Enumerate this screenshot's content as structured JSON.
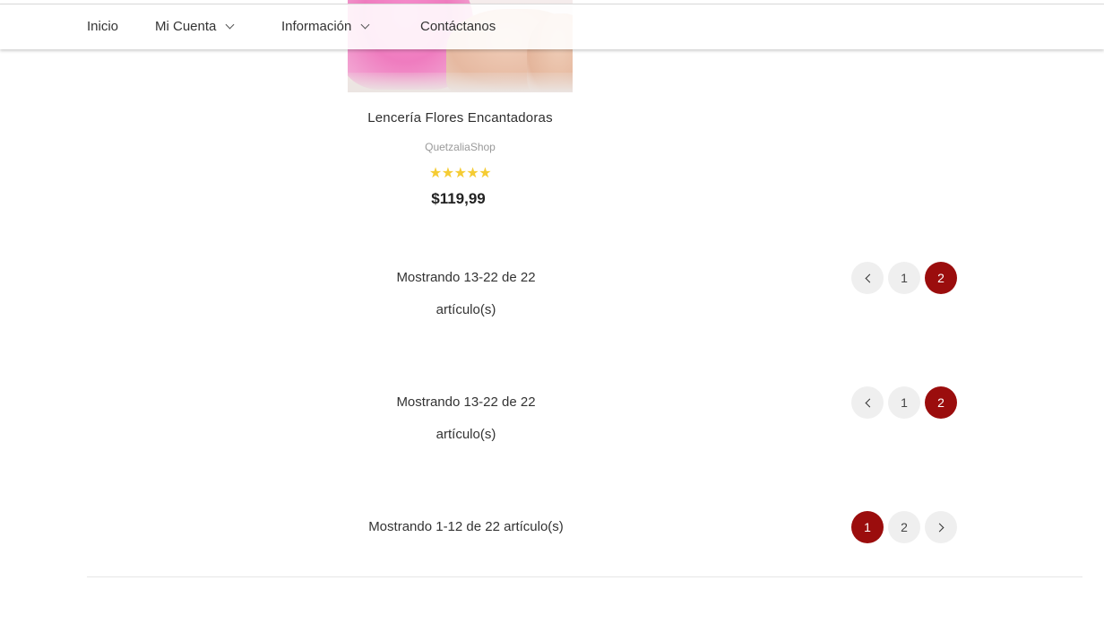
{
  "nav": {
    "items": [
      {
        "label": "Inicio",
        "has_dropdown": false
      },
      {
        "label": "Mi Cuenta",
        "has_dropdown": true
      },
      {
        "label": "Información",
        "has_dropdown": true
      },
      {
        "label": "Contáctanos",
        "has_dropdown": false
      }
    ]
  },
  "product": {
    "name": "Lencería Flores Encantadoras",
    "brand": "QuetzaliaShop",
    "stars": "★★★★★",
    "rating": 5,
    "price": "$119,99"
  },
  "pagination": [
    {
      "text_line1": "Mostrando 13-22 de 22",
      "text_line2": "artículo(s)",
      "buttons": [
        {
          "type": "prev",
          "icon": "chevron-left-icon"
        },
        {
          "type": "page",
          "label": "1",
          "active": false
        },
        {
          "type": "page",
          "label": "2",
          "active": true
        }
      ]
    },
    {
      "text_line1": "Mostrando 13-22 de 22",
      "text_line2": "artículo(s)",
      "buttons": [
        {
          "type": "prev",
          "icon": "chevron-left-icon"
        },
        {
          "type": "page",
          "label": "1",
          "active": false
        },
        {
          "type": "page",
          "label": "2",
          "active": true
        }
      ]
    },
    {
      "text_line1": "Mostrando 1-12 de 22 artículo(s)",
      "buttons": [
        {
          "type": "page",
          "label": "1",
          "active": true
        },
        {
          "type": "page",
          "label": "2",
          "active": false
        },
        {
          "type": "next",
          "icon": "chevron-right-icon"
        }
      ]
    }
  ],
  "colors": {
    "accent": "#9b0d0d",
    "star": "#f5cc33",
    "page_button_bg": "#efefef"
  }
}
